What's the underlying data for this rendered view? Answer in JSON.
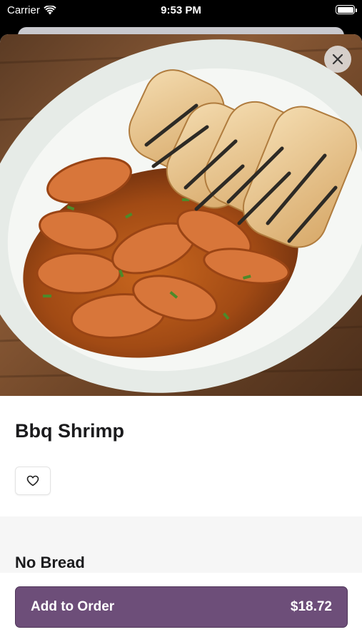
{
  "status": {
    "carrier": "Carrier",
    "time": "9:53 PM"
  },
  "item": {
    "name": "Bbq Shrimp",
    "image": "shrimp-dish-photo"
  },
  "options": {
    "group_title": "No Bread"
  },
  "order": {
    "button_label": "Add to Order",
    "price": "$18.72"
  },
  "colors": {
    "accent": "#6d4e79",
    "sheet_bg": "#ffffff",
    "section_bg": "#f6f6f6"
  }
}
